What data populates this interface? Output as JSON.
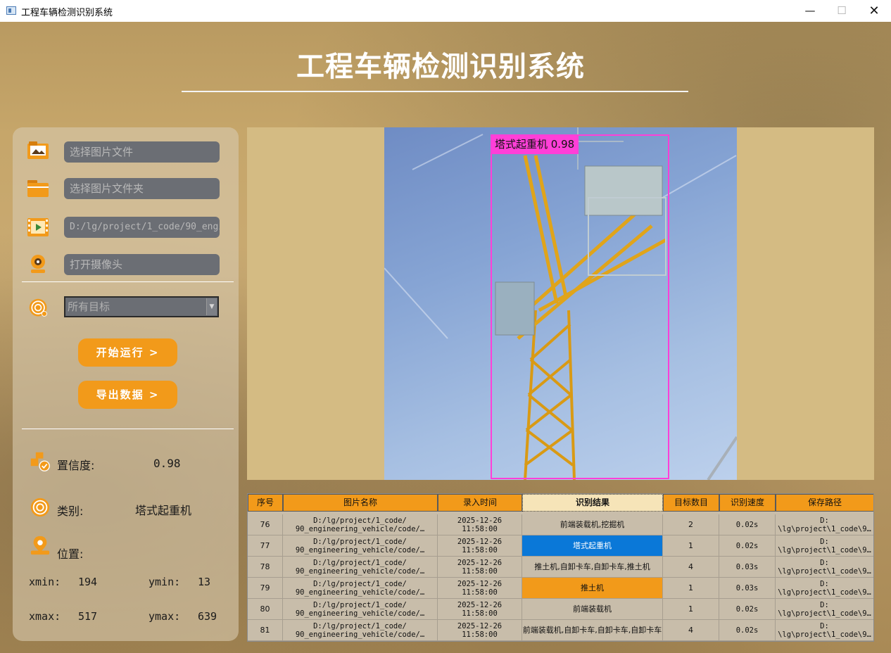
{
  "window": {
    "title": "工程车辆检测识别系统",
    "controls": {
      "minimize": "—",
      "maximize": "☐",
      "close": "✕"
    }
  },
  "header": {
    "title": "工程车辆检测识别系统"
  },
  "inputs": {
    "image_file": {
      "placeholder": "选择图片文件",
      "icon": "image-folder-icon"
    },
    "image_folder": {
      "placeholder": "选择图片文件夹",
      "icon": "folder-icon"
    },
    "video_file": {
      "value": "D:/lg/project/1_code/90_engineering_vehicle/code/",
      "icon": "video-icon"
    },
    "camera": {
      "placeholder": "打开摄像头",
      "icon": "camera-icon"
    }
  },
  "target_select": {
    "value": "所有目标",
    "icon": "target-icon"
  },
  "buttons": {
    "run": "开始运行 >",
    "export": "导出数据 >"
  },
  "info": {
    "confidence_label": "置信度:",
    "confidence_value": "0.98",
    "class_label": "类别:",
    "class_value": "塔式起重机",
    "position_label": "位置:",
    "xmin_label": "xmin:",
    "xmin": "194",
    "ymin_label": "ymin:",
    "ymin": "13",
    "xmax_label": "xmax:",
    "xmax": "517",
    "ymax_label": "ymax:",
    "ymax": "639"
  },
  "detection": {
    "label": "塔式起重机 0.98",
    "box_color": "#ff3fd8"
  },
  "table": {
    "headers": [
      "序号",
      "图片名称",
      "录入时间",
      "识别结果",
      "目标数目",
      "识别速度",
      "保存路径"
    ],
    "rows": [
      {
        "id": "76",
        "name": "D:/lg/project/1_code/ 90_engineering_vehicle/code/…",
        "time": "2025-12-26 11:58:00",
        "result": "前端装载机,挖掘机",
        "count": "2",
        "speed": "0.02s",
        "path": "D: \\lg\\project\\1_code\\9…"
      },
      {
        "id": "77",
        "name": "D:/lg/project/1_code/ 90_engineering_vehicle/code/…",
        "time": "2025-12-26 11:58:00",
        "result": "塔式起重机",
        "count": "1",
        "speed": "0.02s",
        "path": "D: \\lg\\project\\1_code\\9…"
      },
      {
        "id": "78",
        "name": "D:/lg/project/1_code/ 90_engineering_vehicle/code/…",
        "time": "2025-12-26 11:58:00",
        "result": "推土机,自卸卡车,自卸卡车,推土机",
        "count": "4",
        "speed": "0.03s",
        "path": "D: \\lg\\project\\1_code\\9…"
      },
      {
        "id": "79",
        "name": "D:/lg/project/1_code/ 90_engineering_vehicle/code/…",
        "time": "2025-12-26 11:58:00",
        "result": "推土机",
        "count": "1",
        "speed": "0.03s",
        "path": "D: \\lg\\project\\1_code\\9…"
      },
      {
        "id": "80",
        "name": "D:/lg/project/1_code/ 90_engineering_vehicle/code/…",
        "time": "2025-12-26 11:58:00",
        "result": "前端装载机",
        "count": "1",
        "speed": "0.02s",
        "path": "D: \\lg\\project\\1_code\\9…"
      },
      {
        "id": "81",
        "name": "D:/lg/project/1_code/ 90_engineering_vehicle/code/…",
        "time": "2025-12-26 11:58:00",
        "result": "前端装载机,自卸卡车,自卸卡车,自卸卡车",
        "count": "4",
        "speed": "0.02s",
        "path": "D: \\lg\\project\\1_code\\9…"
      }
    ]
  },
  "colors": {
    "accent": "#f29a1a",
    "selected_blue": "#0a78d8",
    "box": "#ff3fd8"
  }
}
